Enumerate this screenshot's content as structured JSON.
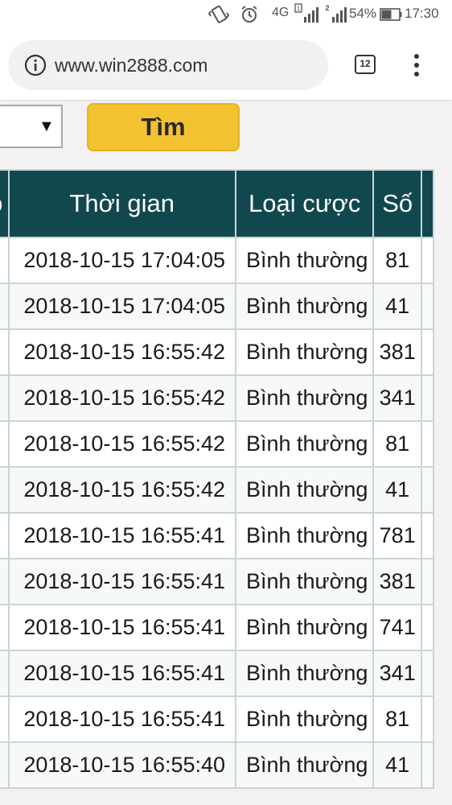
{
  "status_bar": {
    "network": "4G",
    "sim1_label": "1",
    "sim2_label": "2",
    "battery": "54%",
    "time": "17:30",
    "icons": [
      "vibrate-icon",
      "alarm-icon",
      "signal-icon",
      "battery-icon"
    ]
  },
  "browser": {
    "url": "www.win2888.com",
    "tab_count": "12"
  },
  "search": {
    "button_label": "Tìm",
    "select_arrow": "▼",
    "button_color": "#f2c231"
  },
  "table": {
    "header_color": "#11484e",
    "columns": [
      "o",
      "Thời gian",
      "Loại cược",
      "Số"
    ],
    "rows": [
      {
        "time": "2018-10-15 17:04:05",
        "type": "Bình thường",
        "number": "81"
      },
      {
        "time": "2018-10-15 17:04:05",
        "type": "Bình thường",
        "number": "41"
      },
      {
        "time": "2018-10-15 16:55:42",
        "type": "Bình thường",
        "number": "381"
      },
      {
        "time": "2018-10-15 16:55:42",
        "type": "Bình thường",
        "number": "341"
      },
      {
        "time": "2018-10-15 16:55:42",
        "type": "Bình thường",
        "number": "81"
      },
      {
        "time": "2018-10-15 16:55:42",
        "type": "Bình thường",
        "number": "41"
      },
      {
        "time": "2018-10-15 16:55:41",
        "type": "Bình thường",
        "number": "781"
      },
      {
        "time": "2018-10-15 16:55:41",
        "type": "Bình thường",
        "number": "381"
      },
      {
        "time": "2018-10-15 16:55:41",
        "type": "Bình thường",
        "number": "741"
      },
      {
        "time": "2018-10-15 16:55:41",
        "type": "Bình thường",
        "number": "341"
      },
      {
        "time": "2018-10-15 16:55:41",
        "type": "Bình thường",
        "number": "81"
      },
      {
        "time": "2018-10-15 16:55:40",
        "type": "Bình thường",
        "number": "41"
      }
    ]
  }
}
